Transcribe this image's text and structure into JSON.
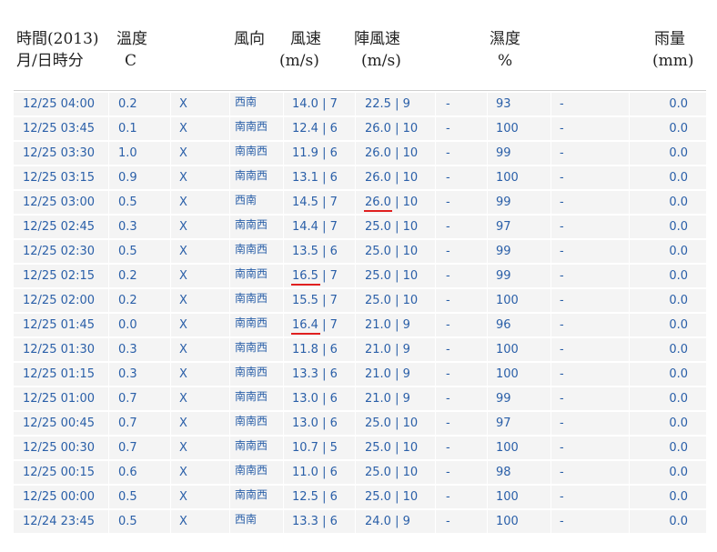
{
  "header": {
    "time_line1": "時間(2013)",
    "time_line2": "月/日時分",
    "temp_line1": "溫度",
    "temp_line2": "C",
    "dir_line1": "風向",
    "speed_line1": "風速",
    "speed_line2": "(m/s)",
    "gust_line1": "陣風速",
    "gust_line2": "(m/s)",
    "hum_line1": "濕度",
    "hum_line2": "%",
    "rain_line1": "雨量",
    "rain_line2": "(mm)"
  },
  "rows": [
    {
      "time": "12/25 04:00",
      "temp": "0.2",
      "x": "X",
      "dir": "西南",
      "speed": "14.0 | 7",
      "gust": "22.5 | 9",
      "d1": "-",
      "hum": "93",
      "d2": "-",
      "rain": "0.0"
    },
    {
      "time": "12/25 03:45",
      "temp": "0.1",
      "x": "X",
      "dir": "南南西",
      "speed": "12.4 | 6",
      "gust": "26.0 | 10",
      "d1": "-",
      "hum": "100",
      "d2": "-",
      "rain": "0.0"
    },
    {
      "time": "12/25 03:30",
      "temp": "1.0",
      "x": "X",
      "dir": "南南西",
      "speed": "11.9 | 6",
      "gust": "26.0 | 10",
      "d1": "-",
      "hum": "99",
      "d2": "-",
      "rain": "0.0"
    },
    {
      "time": "12/25 03:15",
      "temp": "0.9",
      "x": "X",
      "dir": "南南西",
      "speed": "13.1 | 6",
      "gust": "26.0 | 10",
      "d1": "-",
      "hum": "100",
      "d2": "-",
      "rain": "0.0"
    },
    {
      "time": "12/25 03:00",
      "temp": "0.5",
      "x": "X",
      "dir": "西南",
      "speed": "14.5 | 7",
      "gust": "26.0 | 10",
      "d1": "-",
      "hum": "99",
      "d2": "-",
      "rain": "0.0"
    },
    {
      "time": "12/25 02:45",
      "temp": "0.3",
      "x": "X",
      "dir": "南南西",
      "speed": "14.4 | 7",
      "gust": "25.0 | 10",
      "d1": "-",
      "hum": "97",
      "d2": "-",
      "rain": "0.0"
    },
    {
      "time": "12/25 02:30",
      "temp": "0.5",
      "x": "X",
      "dir": "南南西",
      "speed": "13.5 | 6",
      "gust": "25.0 | 10",
      "d1": "-",
      "hum": "99",
      "d2": "-",
      "rain": "0.0"
    },
    {
      "time": "12/25 02:15",
      "temp": "0.2",
      "x": "X",
      "dir": "南南西",
      "speed": "16.5 | 7",
      "gust": "25.0 | 10",
      "d1": "-",
      "hum": "99",
      "d2": "-",
      "rain": "0.0"
    },
    {
      "time": "12/25 02:00",
      "temp": "0.2",
      "x": "X",
      "dir": "南南西",
      "speed": "15.5 | 7",
      "gust": "25.0 | 10",
      "d1": "-",
      "hum": "100",
      "d2": "-",
      "rain": "0.0"
    },
    {
      "time": "12/25 01:45",
      "temp": "0.0",
      "x": "X",
      "dir": "南南西",
      "speed": "16.4 | 7",
      "gust": "21.0 | 9",
      "d1": "-",
      "hum": "96",
      "d2": "-",
      "rain": "0.0"
    },
    {
      "time": "12/25 01:30",
      "temp": "0.3",
      "x": "X",
      "dir": "南南西",
      "speed": "11.8 | 6",
      "gust": "21.0 | 9",
      "d1": "-",
      "hum": "100",
      "d2": "-",
      "rain": "0.0"
    },
    {
      "time": "12/25 01:15",
      "temp": "0.3",
      "x": "X",
      "dir": "南南西",
      "speed": "13.3 | 6",
      "gust": "21.0 | 9",
      "d1": "-",
      "hum": "100",
      "d2": "-",
      "rain": "0.0"
    },
    {
      "time": "12/25 01:00",
      "temp": "0.7",
      "x": "X",
      "dir": "南南西",
      "speed": "13.0 | 6",
      "gust": "21.0 | 9",
      "d1": "-",
      "hum": "99",
      "d2": "-",
      "rain": "0.0"
    },
    {
      "time": "12/25 00:45",
      "temp": "0.7",
      "x": "X",
      "dir": "南南西",
      "speed": "13.0 | 6",
      "gust": "25.0 | 10",
      "d1": "-",
      "hum": "97",
      "d2": "-",
      "rain": "0.0"
    },
    {
      "time": "12/25 00:30",
      "temp": "0.7",
      "x": "X",
      "dir": "南南西",
      "speed": "10.7 | 5",
      "gust": "25.0 | 10",
      "d1": "-",
      "hum": "100",
      "d2": "-",
      "rain": "0.0"
    },
    {
      "time": "12/25 00:15",
      "temp": "0.6",
      "x": "X",
      "dir": "南南西",
      "speed": "11.0 | 6",
      "gust": "25.0 | 10",
      "d1": "-",
      "hum": "98",
      "d2": "-",
      "rain": "0.0"
    },
    {
      "time": "12/25 00:00",
      "temp": "0.5",
      "x": "X",
      "dir": "南南西",
      "speed": "12.5 | 6",
      "gust": "25.0 | 10",
      "d1": "-",
      "hum": "100",
      "d2": "-",
      "rain": "0.0"
    },
    {
      "time": "12/24 23:45",
      "temp": "0.5",
      "x": "X",
      "dir": "西南",
      "speed": "13.3 | 6",
      "gust": "24.0 | 9",
      "d1": "-",
      "hum": "100",
      "d2": "-",
      "rain": "0.0"
    }
  ],
  "colors": {
    "text": "#2a5fa8",
    "row_bg": "#f4f4f4",
    "underline": "#e02020"
  }
}
